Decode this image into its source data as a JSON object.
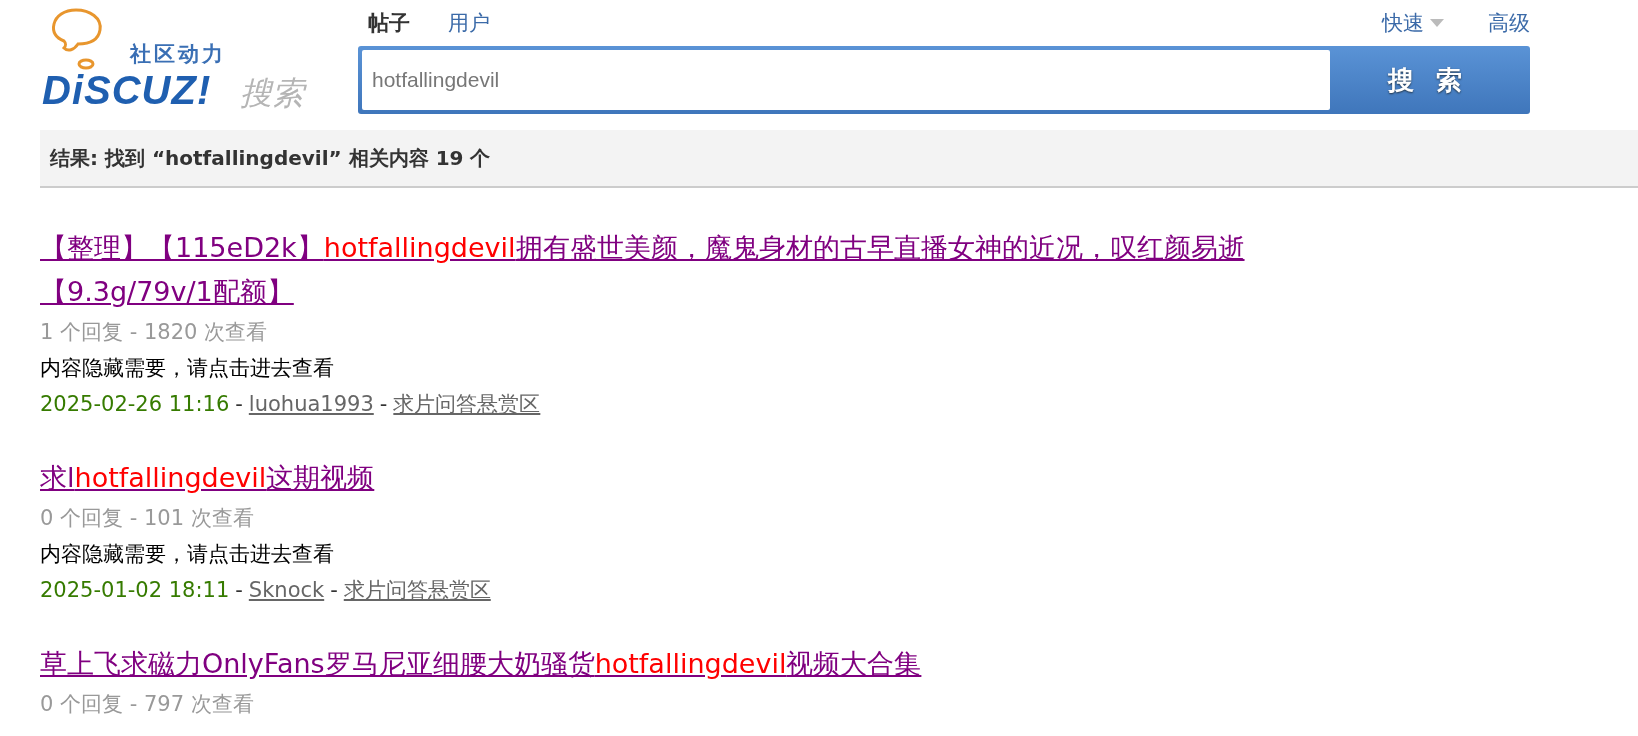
{
  "logo": {
    "tagline": "社区动力",
    "wordmark": "DiSCUZ!",
    "suffix": "搜索"
  },
  "tabs": [
    {
      "label": "帖子",
      "selected": true
    },
    {
      "label": "用户",
      "selected": false
    }
  ],
  "links": {
    "quick": "快速",
    "advanced": "高级"
  },
  "search": {
    "value": "hotfallingdevil",
    "button": "搜 索"
  },
  "summary": {
    "label": "结果: 找到 “hotfallingdevil” 相关内容 19 个"
  },
  "results": [
    {
      "title": [
        {
          "text": "【整理】【115eD2k】",
          "highlight": false
        },
        {
          "text": "hotfallingdevil",
          "highlight": true
        },
        {
          "text": "拥有盛世美颜，魔鬼身材的古早直播女神的近况，叹红颜易逝【9.3g/79v/1配额】",
          "highlight": false
        }
      ],
      "stats": "1 个回复 - 1820 次查看",
      "excerpt": "内容隐藏需要，请点击进去查看",
      "date": "2025-02-26 11:16",
      "separators": [
        "-",
        "-"
      ],
      "author": "luohua1993",
      "forum": "求片问答悬赏区"
    },
    {
      "title": [
        {
          "text": "求l",
          "highlight": false
        },
        {
          "text": "hotfallingdevil",
          "highlight": true
        },
        {
          "text": "这期视频",
          "highlight": false
        }
      ],
      "stats": "0 个回复 - 101 次查看",
      "excerpt": "内容隐藏需要，请点击进去查看",
      "date": "2025-01-02 18:11",
      "separators": [
        "-",
        "-"
      ],
      "author": "Sknock",
      "forum": "求片问答悬赏区"
    },
    {
      "title": [
        {
          "text": "草上飞求磁力OnlyFans罗马尼亚细腰大奶骚货",
          "highlight": false
        },
        {
          "text": "hotfallingdevil",
          "highlight": true
        },
        {
          "text": "视频大合集",
          "highlight": false
        }
      ],
      "stats": "0 个回复 - 797 次查看"
    }
  ]
}
